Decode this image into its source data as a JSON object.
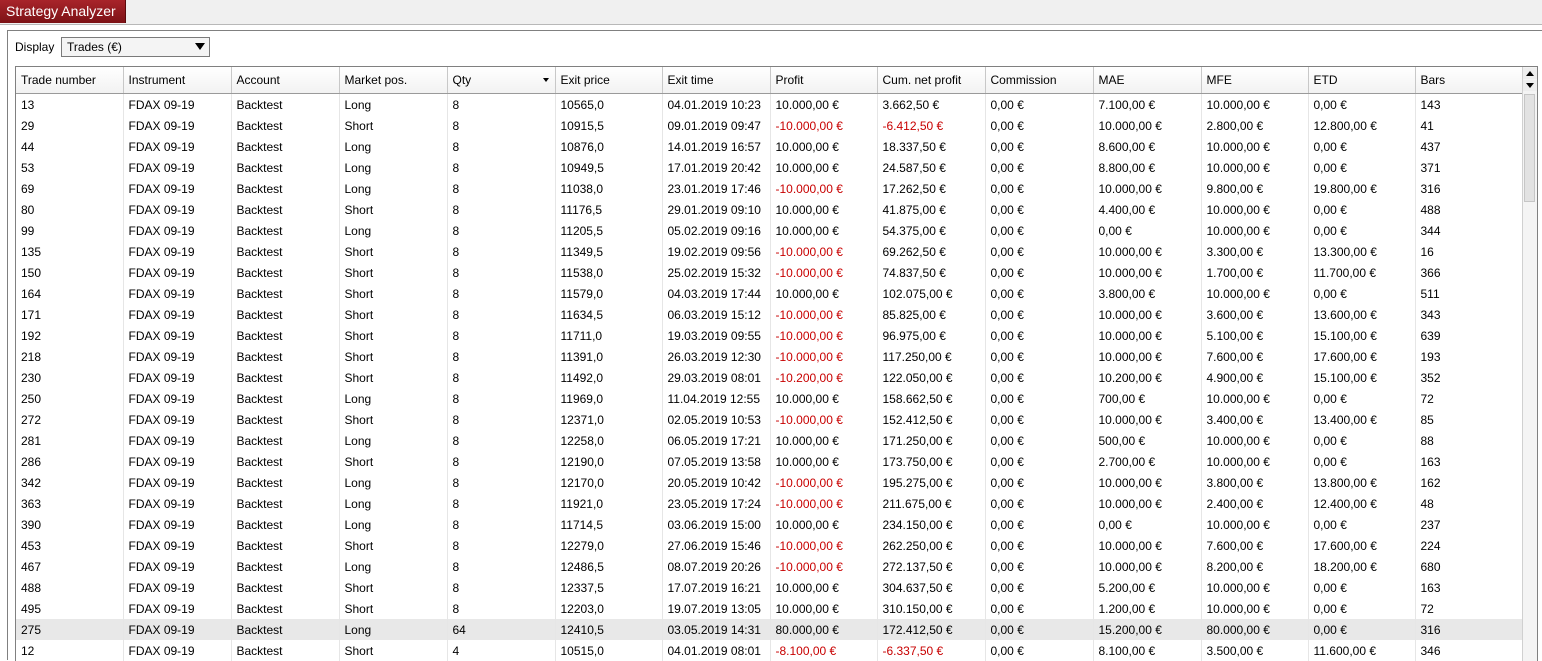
{
  "window": {
    "tab_title": "Strategy Analyzer"
  },
  "display": {
    "label": "Display",
    "selected": "Trades (€)"
  },
  "columns": [
    "Trade number",
    "Instrument",
    "Account",
    "Market pos.",
    "Qty",
    "Exit price",
    "Exit time",
    "Profit",
    "Cum. net profit",
    "Commission",
    "MAE",
    "MFE",
    "ETD",
    "Bars"
  ],
  "sorted_column": "Qty",
  "negative_color": "#c80000",
  "rows": [
    [
      "13",
      "FDAX 09-19",
      "Backtest",
      "Long",
      "8",
      "10565,0",
      "04.01.2019 10:23",
      "10.000,00 €",
      "3.662,50 €",
      "0,00 €",
      "7.100,00 €",
      "10.000,00 €",
      "0,00 €",
      "143"
    ],
    [
      "29",
      "FDAX 09-19",
      "Backtest",
      "Short",
      "8",
      "10915,5",
      "09.01.2019 09:47",
      "-10.000,00 €",
      "-6.412,50 €",
      "0,00 €",
      "10.000,00 €",
      "2.800,00 €",
      "12.800,00 €",
      "41"
    ],
    [
      "44",
      "FDAX 09-19",
      "Backtest",
      "Long",
      "8",
      "10876,0",
      "14.01.2019 16:57",
      "10.000,00 €",
      "18.337,50 €",
      "0,00 €",
      "8.600,00 €",
      "10.000,00 €",
      "0,00 €",
      "437"
    ],
    [
      "53",
      "FDAX 09-19",
      "Backtest",
      "Long",
      "8",
      "10949,5",
      "17.01.2019 20:42",
      "10.000,00 €",
      "24.587,50 €",
      "0,00 €",
      "8.800,00 €",
      "10.000,00 €",
      "0,00 €",
      "371"
    ],
    [
      "69",
      "FDAX 09-19",
      "Backtest",
      "Long",
      "8",
      "11038,0",
      "23.01.2019 17:46",
      "-10.000,00 €",
      "17.262,50 €",
      "0,00 €",
      "10.000,00 €",
      "9.800,00 €",
      "19.800,00 €",
      "316"
    ],
    [
      "80",
      "FDAX 09-19",
      "Backtest",
      "Short",
      "8",
      "11176,5",
      "29.01.2019 09:10",
      "10.000,00 €",
      "41.875,00 €",
      "0,00 €",
      "4.400,00 €",
      "10.000,00 €",
      "0,00 €",
      "488"
    ],
    [
      "99",
      "FDAX 09-19",
      "Backtest",
      "Long",
      "8",
      "11205,5",
      "05.02.2019 09:16",
      "10.000,00 €",
      "54.375,00 €",
      "0,00 €",
      "0,00 €",
      "10.000,00 €",
      "0,00 €",
      "344"
    ],
    [
      "135",
      "FDAX 09-19",
      "Backtest",
      "Short",
      "8",
      "11349,5",
      "19.02.2019 09:56",
      "-10.000,00 €",
      "69.262,50 €",
      "0,00 €",
      "10.000,00 €",
      "3.300,00 €",
      "13.300,00 €",
      "16"
    ],
    [
      "150",
      "FDAX 09-19",
      "Backtest",
      "Short",
      "8",
      "11538,0",
      "25.02.2019 15:32",
      "-10.000,00 €",
      "74.837,50 €",
      "0,00 €",
      "10.000,00 €",
      "1.700,00 €",
      "11.700,00 €",
      "366"
    ],
    [
      "164",
      "FDAX 09-19",
      "Backtest",
      "Short",
      "8",
      "11579,0",
      "04.03.2019 17:44",
      "10.000,00 €",
      "102.075,00 €",
      "0,00 €",
      "3.800,00 €",
      "10.000,00 €",
      "0,00 €",
      "511"
    ],
    [
      "171",
      "FDAX 09-19",
      "Backtest",
      "Short",
      "8",
      "11634,5",
      "06.03.2019 15:12",
      "-10.000,00 €",
      "85.825,00 €",
      "0,00 €",
      "10.000,00 €",
      "3.600,00 €",
      "13.600,00 €",
      "343"
    ],
    [
      "192",
      "FDAX 09-19",
      "Backtest",
      "Short",
      "8",
      "11711,0",
      "19.03.2019 09:55",
      "-10.000,00 €",
      "96.975,00 €",
      "0,00 €",
      "10.000,00 €",
      "5.100,00 €",
      "15.100,00 €",
      "639"
    ],
    [
      "218",
      "FDAX 09-19",
      "Backtest",
      "Short",
      "8",
      "11391,0",
      "26.03.2019 12:30",
      "-10.000,00 €",
      "117.250,00 €",
      "0,00 €",
      "10.000,00 €",
      "7.600,00 €",
      "17.600,00 €",
      "193"
    ],
    [
      "230",
      "FDAX 09-19",
      "Backtest",
      "Short",
      "8",
      "11492,0",
      "29.03.2019 08:01",
      "-10.200,00 €",
      "122.050,00 €",
      "0,00 €",
      "10.200,00 €",
      "4.900,00 €",
      "15.100,00 €",
      "352"
    ],
    [
      "250",
      "FDAX 09-19",
      "Backtest",
      "Long",
      "8",
      "11969,0",
      "11.04.2019 12:55",
      "10.000,00 €",
      "158.662,50 €",
      "0,00 €",
      "700,00 €",
      "10.000,00 €",
      "0,00 €",
      "72"
    ],
    [
      "272",
      "FDAX 09-19",
      "Backtest",
      "Short",
      "8",
      "12371,0",
      "02.05.2019 10:53",
      "-10.000,00 €",
      "152.412,50 €",
      "0,00 €",
      "10.000,00 €",
      "3.400,00 €",
      "13.400,00 €",
      "85"
    ],
    [
      "281",
      "FDAX 09-19",
      "Backtest",
      "Long",
      "8",
      "12258,0",
      "06.05.2019 17:21",
      "10.000,00 €",
      "171.250,00 €",
      "0,00 €",
      "500,00 €",
      "10.000,00 €",
      "0,00 €",
      "88"
    ],
    [
      "286",
      "FDAX 09-19",
      "Backtest",
      "Short",
      "8",
      "12190,0",
      "07.05.2019 13:58",
      "10.000,00 €",
      "173.750,00 €",
      "0,00 €",
      "2.700,00 €",
      "10.000,00 €",
      "0,00 €",
      "163"
    ],
    [
      "342",
      "FDAX 09-19",
      "Backtest",
      "Long",
      "8",
      "12170,0",
      "20.05.2019 10:42",
      "-10.000,00 €",
      "195.275,00 €",
      "0,00 €",
      "10.000,00 €",
      "3.800,00 €",
      "13.800,00 €",
      "162"
    ],
    [
      "363",
      "FDAX 09-19",
      "Backtest",
      "Long",
      "8",
      "11921,0",
      "23.05.2019 17:24",
      "-10.000,00 €",
      "211.675,00 €",
      "0,00 €",
      "10.000,00 €",
      "2.400,00 €",
      "12.400,00 €",
      "48"
    ],
    [
      "390",
      "FDAX 09-19",
      "Backtest",
      "Long",
      "8",
      "11714,5",
      "03.06.2019 15:00",
      "10.000,00 €",
      "234.150,00 €",
      "0,00 €",
      "0,00 €",
      "10.000,00 €",
      "0,00 €",
      "237"
    ],
    [
      "453",
      "FDAX 09-19",
      "Backtest",
      "Short",
      "8",
      "12279,0",
      "27.06.2019 15:46",
      "-10.000,00 €",
      "262.250,00 €",
      "0,00 €",
      "10.000,00 €",
      "7.600,00 €",
      "17.600,00 €",
      "224"
    ],
    [
      "467",
      "FDAX 09-19",
      "Backtest",
      "Long",
      "8",
      "12486,5",
      "08.07.2019 20:26",
      "-10.000,00 €",
      "272.137,50 €",
      "0,00 €",
      "10.000,00 €",
      "8.200,00 €",
      "18.200,00 €",
      "680"
    ],
    [
      "488",
      "FDAX 09-19",
      "Backtest",
      "Short",
      "8",
      "12337,5",
      "17.07.2019 16:21",
      "10.000,00 €",
      "304.637,50 €",
      "0,00 €",
      "5.200,00 €",
      "10.000,00 €",
      "0,00 €",
      "163"
    ],
    [
      "495",
      "FDAX 09-19",
      "Backtest",
      "Short",
      "8",
      "12203,0",
      "19.07.2019 13:05",
      "10.000,00 €",
      "310.150,00 €",
      "0,00 €",
      "1.200,00 €",
      "10.000,00 €",
      "0,00 €",
      "72"
    ],
    [
      "275",
      "FDAX 09-19",
      "Backtest",
      "Long",
      "64",
      "12410,5",
      "03.05.2019 14:31",
      "80.000,00 €",
      "172.412,50 €",
      "0,00 €",
      "15.200,00 €",
      "80.000,00 €",
      "0,00 €",
      "316"
    ],
    [
      "12",
      "FDAX 09-19",
      "Backtest",
      "Short",
      "4",
      "10515,0",
      "04.01.2019 08:01",
      "-8.100,00 €",
      "-6.337,50 €",
      "0,00 €",
      "8.100,00 €",
      "3.500,00 €",
      "11.600,00 €",
      "346"
    ]
  ],
  "highlighted_row_index": 25
}
